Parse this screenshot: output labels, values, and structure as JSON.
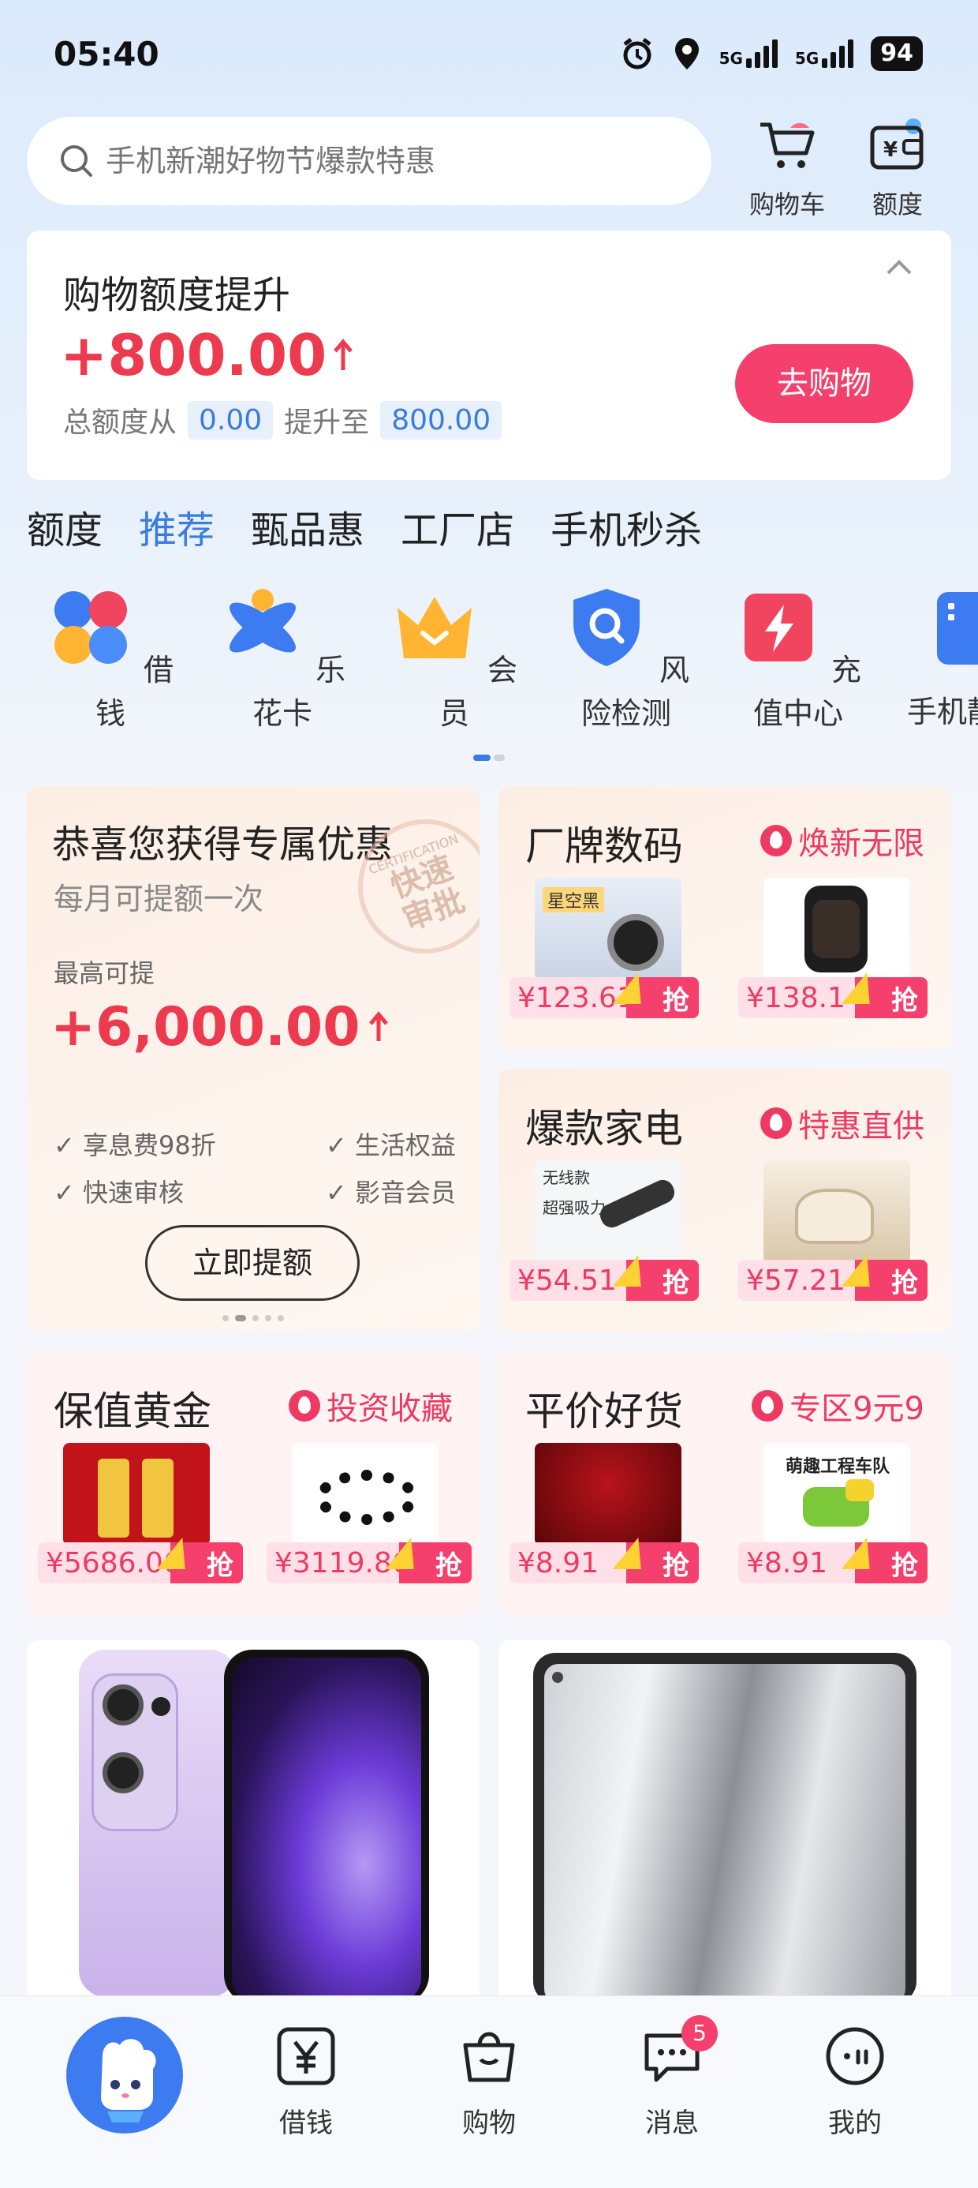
{
  "status_bar": {
    "time": "05:40",
    "net1": "5G",
    "net2": "5G",
    "battery": "94"
  },
  "search": {
    "placeholder": "手机新潮好物节爆款特惠"
  },
  "top_actions": [
    {
      "label": "购物车"
    },
    {
      "label": "额度"
    }
  ],
  "quota_card": {
    "title": "购物额度提升",
    "amount": "+800.00",
    "from_text": "总额度从",
    "from_value": "0.00",
    "to_text": "提升至",
    "to_value": "800.00",
    "button": "去购物"
  },
  "tabs": [
    {
      "label": "额度",
      "active": false
    },
    {
      "label": "推荐",
      "active": true
    },
    {
      "label": "甄品惠",
      "active": false
    },
    {
      "label": "工厂店",
      "active": false
    },
    {
      "label": "手机秒杀",
      "active": false
    }
  ],
  "quick_icons": [
    {
      "label": "借钱",
      "icon": "clover-icon"
    },
    {
      "label": "乐花卡",
      "icon": "flower-x-icon"
    },
    {
      "label": "会员",
      "icon": "crown-icon"
    },
    {
      "label": "风险检测",
      "icon": "shield-search-icon"
    },
    {
      "label": "充值中心",
      "icon": "lightning-icon"
    },
    {
      "label": "手机靓",
      "icon": "phone-icon"
    }
  ],
  "promo_card": {
    "title": "恭喜您获得专属优惠",
    "subtitle": "每月可提额一次",
    "stamp_text": "快速审批",
    "stamp_small": "CERTIFICATION",
    "max_label": "最高可提",
    "max_amount": "+6,000.00",
    "benefits": [
      "享息费98折",
      "生活权益",
      "快速审核",
      "影音会员"
    ],
    "button": "立即提额"
  },
  "mini_cards": [
    {
      "title": "厂牌数码",
      "tag": "焕新无限",
      "items": [
        {
          "price": "¥123.61"
        },
        {
          "price": "¥138.1"
        }
      ]
    },
    {
      "title": "爆款家电",
      "tag": "特惠直供",
      "items": [
        {
          "price": "¥54.51"
        },
        {
          "price": "¥57.21"
        }
      ]
    },
    {
      "title": "保值黄金",
      "tag": "投资收藏",
      "items": [
        {
          "price": "¥5686.06"
        },
        {
          "price": "¥3119.86"
        }
      ]
    },
    {
      "title": "平价好货",
      "tag": "专区9元9",
      "items": [
        {
          "price": "¥8.91"
        },
        {
          "price": "¥8.91"
        }
      ]
    }
  ],
  "grab_label": "抢",
  "product_thumb_texts": {
    "earbuds": "星空黑",
    "vacuum1": "无线款",
    "vacuum2": "超强吸力",
    "truck": "萌趣工程车队"
  },
  "bottom_nav": [
    {
      "label": ""
    },
    {
      "label": "借钱"
    },
    {
      "label": "购物"
    },
    {
      "label": "消息",
      "badge": "5"
    },
    {
      "label": "我的"
    }
  ],
  "colors": {
    "accent": "#3a7ce0",
    "brand_pink": "#f53f6d",
    "price_red": "#ee3a4e"
  }
}
